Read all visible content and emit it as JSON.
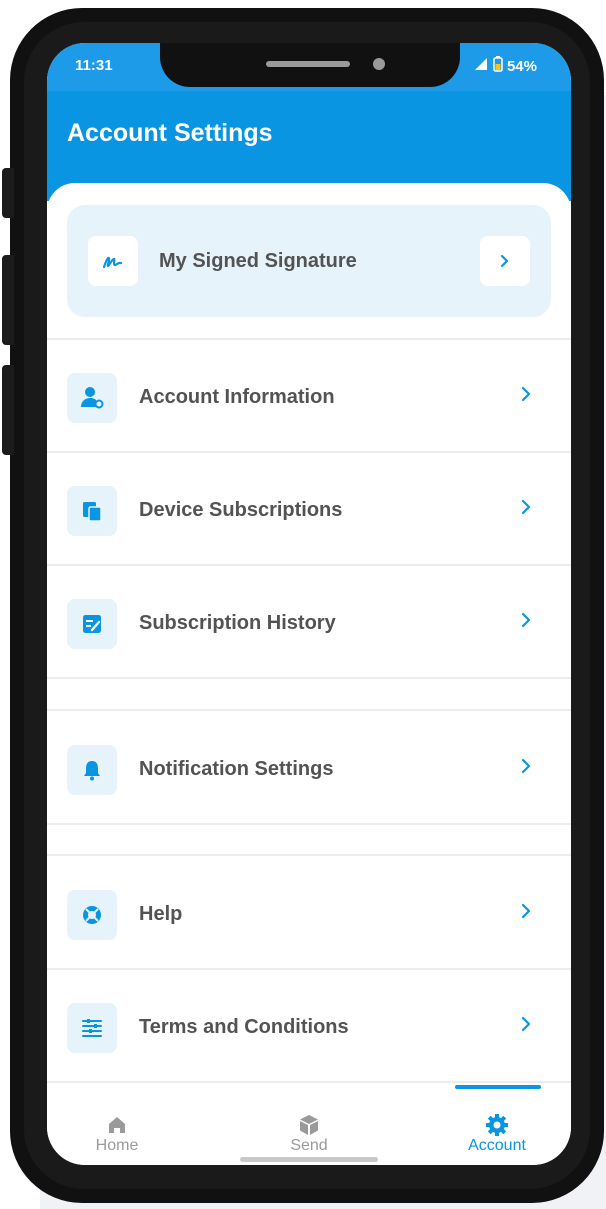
{
  "status_bar": {
    "time": "11:31",
    "battery": "54%"
  },
  "header": {
    "title": "Account Settings"
  },
  "signature_card": {
    "label": "My Signed Signature",
    "icon": "signature-icon"
  },
  "menu": {
    "items": [
      {
        "label": "Account Information",
        "icon": "user-gear-icon"
      },
      {
        "label": "Device Subscriptions",
        "icon": "copy-icon"
      },
      {
        "label": "Subscription History",
        "icon": "edit-list-icon"
      },
      {
        "label": "Notification Settings",
        "icon": "bell-icon"
      },
      {
        "label": "Help",
        "icon": "lifebuoy-icon"
      },
      {
        "label": "Terms and Conditions",
        "icon": "list-lines-icon"
      }
    ]
  },
  "tabs": [
    {
      "label": "Home",
      "icon": "home-icon"
    },
    {
      "label": "Send",
      "icon": "box-icon"
    },
    {
      "label": "Account",
      "icon": "gear-icon",
      "active": true
    }
  ],
  "colors": {
    "primary": "#0a95e2",
    "card_bg": "#e6f3fb",
    "text": "#535353",
    "muted": "#9a9a9a"
  }
}
